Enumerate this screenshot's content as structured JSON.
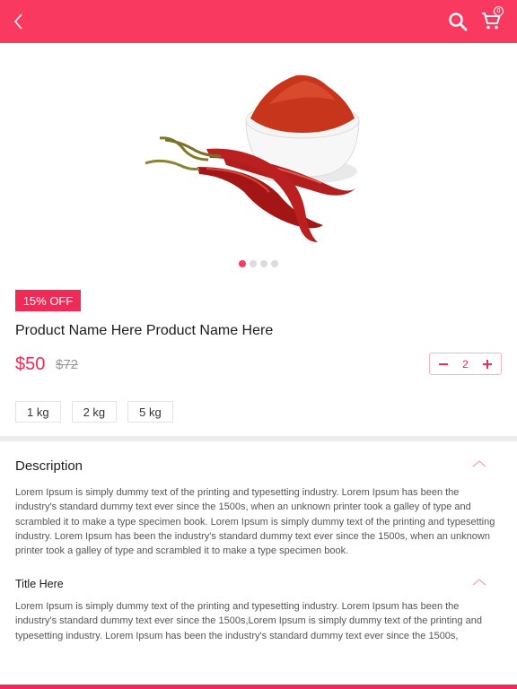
{
  "colors": {
    "accent": "#f9395f",
    "price": "#ee2b56"
  },
  "app_bar": {
    "back_icon": "chevron-left-icon",
    "search_icon": "search-icon",
    "cart_icon": "cart-icon",
    "cart_count": "0"
  },
  "product": {
    "image_alt": "red chili powder and chillies",
    "discount": "15% OFF",
    "name": "Product Name Here Product Name Here",
    "price": "$50",
    "old_price": "$72",
    "quantity": "2",
    "carousel": {
      "total": 4,
      "active": 1
    },
    "sizes": [
      "1 kg",
      "2 kg",
      "5 kg"
    ]
  },
  "description": {
    "title": "Description",
    "text": "Lorem Ipsum is simply dummy text of the printing and typesetting industry. Lorem Ipsum has been the industry's standard dummy text ever since the 1500s, when an unknown printer took a galley of type and scrambled it to make a type specimen book. Lorem Ipsum is simply dummy text of the printing and typesetting industry. Lorem Ipsum has been the industry's standard dummy text ever since the 1500s, when an unknown printer took a galley of type and scrambled it to make a type specimen book."
  },
  "section2": {
    "title": "Title Here",
    "text": "Lorem Ipsum is simply dummy text of the printing and typesetting industry. Lorem Ipsum has been the industry's standard dummy text ever since the 1500s,Lorem Ipsum is simply dummy text of the printing and typesetting industry. Lorem Ipsum has been the industry's standard dummy text ever since the 1500s,"
  }
}
